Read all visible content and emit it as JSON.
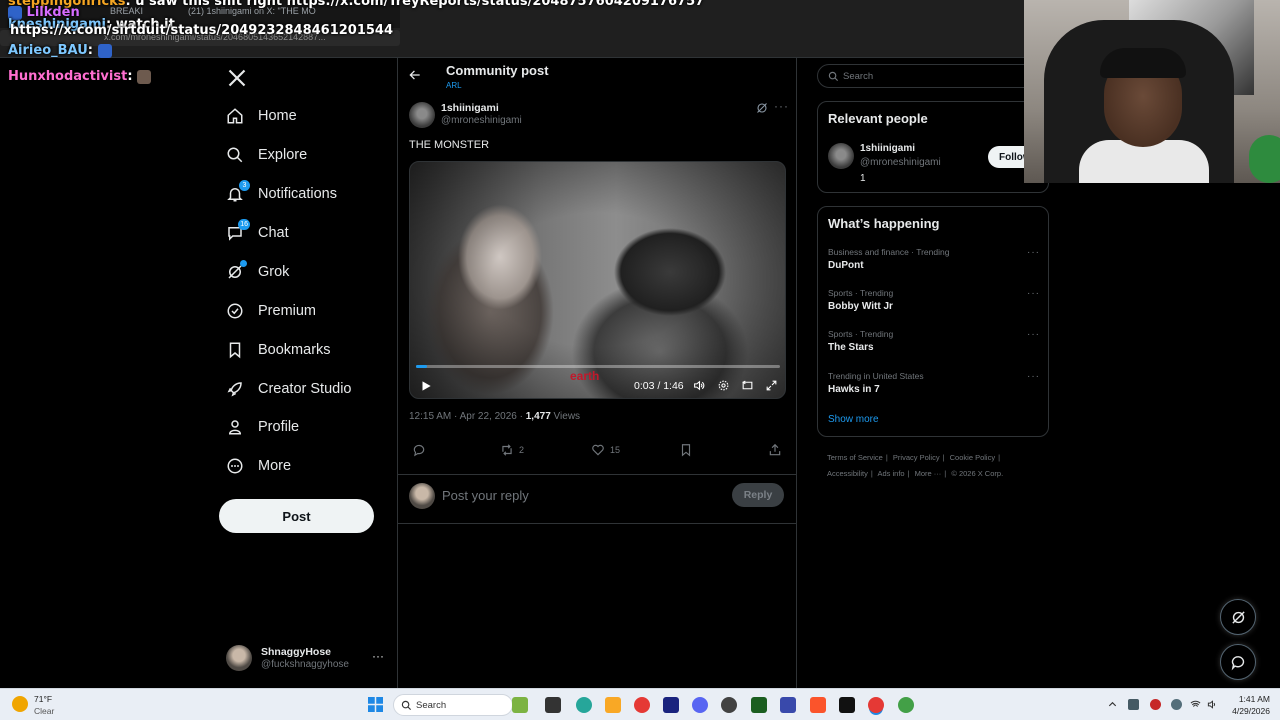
{
  "browser": {
    "tabs": [
      {
        "label": "BREAKI"
      },
      {
        "label": "(21) 1shiinigami on X: \"THE MO"
      }
    ],
    "address": "x.com/mroneshinigami/status/2046805143652142887..."
  },
  "chat_overlay": [
    {
      "user": "steppingonricks",
      "message": "u saw this shit right https://x.com/TreyReports/status/2048757604209176757"
    },
    {
      "user": "Lilkden",
      "message": ""
    },
    {
      "user": "kneshinigami",
      "message": "watch it"
    },
    {
      "user": "",
      "message": "https://x.com/sirtduit/status/2049232848461201544"
    },
    {
      "user": "Airieo_BAU",
      "message": ""
    },
    {
      "user": "Hunxhodactivist",
      "message": ""
    }
  ],
  "nav": {
    "items": [
      {
        "label": "Home",
        "icon": "home-icon",
        "badge": ""
      },
      {
        "label": "Explore",
        "icon": "search-icon",
        "badge": ""
      },
      {
        "label": "Notifications",
        "icon": "bell-icon",
        "badge": "3"
      },
      {
        "label": "Chat",
        "icon": "chat-icon",
        "badge": "16"
      },
      {
        "label": "Grok",
        "icon": "grok-icon",
        "badge": ""
      },
      {
        "label": "Premium",
        "icon": "premium-icon",
        "badge": ""
      },
      {
        "label": "Bookmarks",
        "icon": "bookmark-icon",
        "badge": ""
      },
      {
        "label": "Creator Studio",
        "icon": "rocket-icon",
        "badge": ""
      },
      {
        "label": "Profile",
        "icon": "person-icon",
        "badge": ""
      },
      {
        "label": "More",
        "icon": "more-circle-icon",
        "badge": ""
      }
    ],
    "post_label": "Post",
    "account": {
      "name": "ShnaggyHose",
      "handle": "@fuckshnaggyhose",
      "more": "···"
    }
  },
  "main": {
    "header_title": "Community post",
    "header_sub": "ARL",
    "author_name": "1shiinigami",
    "author_handle": "@mroneshinigami",
    "post_text": "THE MONSTER",
    "video": {
      "time": "0:03 / 1:46",
      "progress_fraction": 0.03,
      "caption": "earth"
    },
    "timestamp": "12:15 AM · Apr 22, 2026 · ",
    "views_count": "1,477",
    "views_label": " Views",
    "actions": {
      "reposts": "2",
      "likes": "15"
    },
    "reply_placeholder": "Post your reply",
    "reply_button": "Reply"
  },
  "right": {
    "search_placeholder": "Search",
    "relevant_title": "Relevant people",
    "person": {
      "name": "1shiinigami",
      "handle": "@mroneshinigami",
      "bio": "1",
      "follow_label": "Follow"
    },
    "happening_title": "What’s happening",
    "trends": [
      {
        "category": "Business and finance · Trending",
        "title": "DuPont"
      },
      {
        "category": "Sports · Trending",
        "title": "Bobby Witt Jr"
      },
      {
        "category": "Sports · Trending",
        "title": "The Stars"
      },
      {
        "category": "Trending in United States",
        "title": "Hawks in 7"
      }
    ],
    "show_more": "Show more",
    "footer": [
      "Terms of Service",
      "|",
      "Privacy Policy",
      "|",
      "Cookie Policy",
      "|",
      "Accessibility",
      "|",
      "Ads info",
      "|",
      "More ···",
      "|",
      "© 2026 X Corp."
    ]
  },
  "taskbar": {
    "weather_temp": "71°F",
    "weather_desc": "Clear",
    "search_label": "Search",
    "time": "1:41 AM",
    "date": "4/29/2026"
  },
  "colors": {
    "accent": "#1d9bf0",
    "bg": "#000000",
    "text": "#e7e9ea",
    "muted": "#71767b",
    "border": "#2f3336"
  }
}
